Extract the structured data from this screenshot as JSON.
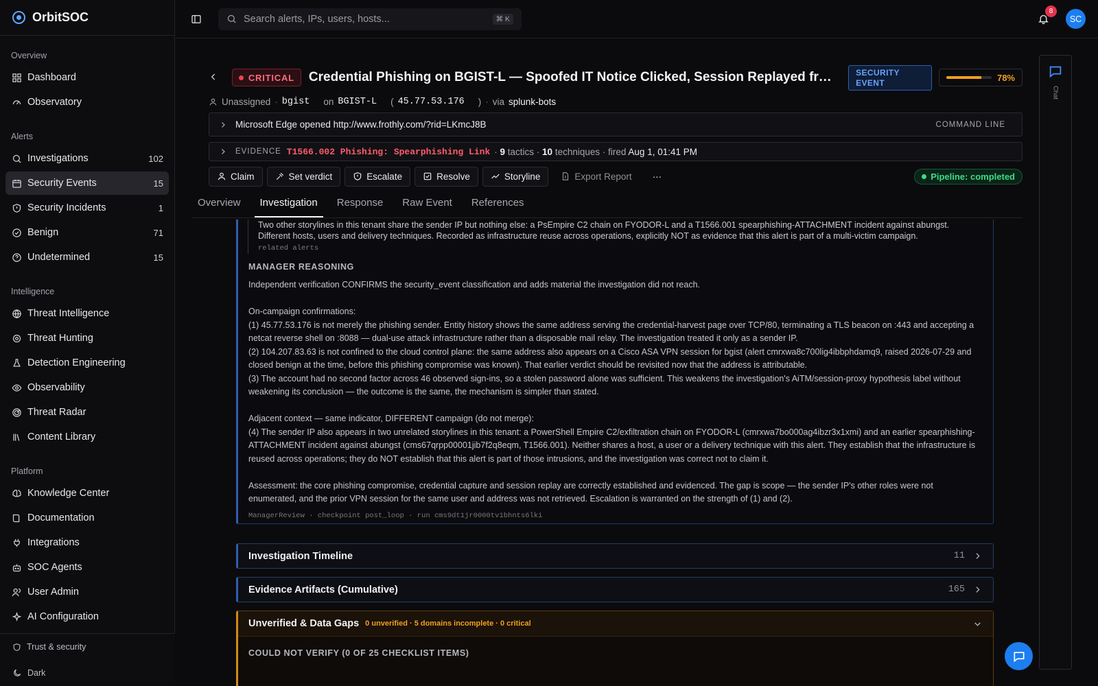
{
  "brand": {
    "name": "OrbitSOC"
  },
  "sidebar": {
    "sections": [
      {
        "title": "Overview",
        "items": [
          {
            "label": "Dashboard",
            "icon": "dashboard-icon",
            "count": ""
          },
          {
            "label": "Observatory",
            "icon": "gauge-icon",
            "count": ""
          }
        ]
      },
      {
        "title": "Alerts",
        "items": [
          {
            "label": "Investigations",
            "icon": "search-icon",
            "count": "102"
          },
          {
            "label": "Security Events",
            "icon": "calendar-alert-icon",
            "count": "15",
            "active": true
          },
          {
            "label": "Security Incidents",
            "icon": "shield-alert-icon",
            "count": "1"
          },
          {
            "label": "Benign",
            "icon": "check-circle-icon",
            "count": "71"
          },
          {
            "label": "Undetermined",
            "icon": "question-circle-icon",
            "count": "15"
          }
        ]
      },
      {
        "title": "Intelligence",
        "items": [
          {
            "label": "Threat Intelligence",
            "icon": "globe-icon",
            "count": ""
          },
          {
            "label": "Threat Hunting",
            "icon": "crosshair-icon",
            "count": ""
          },
          {
            "label": "Detection Engineering",
            "icon": "flask-icon",
            "count": ""
          },
          {
            "label": "Observability",
            "icon": "eye-icon",
            "count": ""
          },
          {
            "label": "Threat Radar",
            "icon": "radar-icon",
            "count": ""
          },
          {
            "label": "Content Library",
            "icon": "library-icon",
            "count": ""
          }
        ]
      },
      {
        "title": "Platform",
        "items": [
          {
            "label": "Knowledge Center",
            "icon": "brain-icon",
            "count": ""
          },
          {
            "label": "Documentation",
            "icon": "book-icon",
            "count": ""
          },
          {
            "label": "Integrations",
            "icon": "plug-icon",
            "count": ""
          },
          {
            "label": "SOC Agents",
            "icon": "bot-icon",
            "count": ""
          },
          {
            "label": "User Admin",
            "icon": "users-icon",
            "count": ""
          },
          {
            "label": "AI Configuration",
            "icon": "sparkles-icon",
            "count": ""
          }
        ]
      }
    ],
    "footer": {
      "trust": "Trust & security",
      "theme": "Dark"
    }
  },
  "topbar": {
    "search_placeholder": "Search alerts, IPs, users, hosts...",
    "shortcut": "⌘ K",
    "notifications": "8",
    "avatar": "SC"
  },
  "alert": {
    "severity": "CRITICAL",
    "title": "Credential Phishing on BGIST-L — Spoofed IT Notice Clicked, Session Replayed from H...",
    "classification": "SECURITY EVENT",
    "confidence_label": "78%",
    "confidence": 0.78,
    "meta": {
      "assignee": "Unassigned",
      "user": "bgist",
      "on": "on",
      "host": "BGIST-L",
      "ip_open": "(",
      "ip": "45.77.53.176",
      "ip_close": ")",
      "via": "via",
      "source": "splunk-bots"
    },
    "command": {
      "text": "Microsoft Edge opened http://www.frothly.com/?rid=LKmcJ8B",
      "tag": "COMMAND LINE"
    },
    "evidence": {
      "label": "EVIDENCE",
      "technique": "T1566.002 Phishing: Spearphishing Link",
      "tactics_count": "9",
      "tactics_label": "tactics",
      "techniques_count": "10",
      "techniques_label": "techniques · fired",
      "fired": "Aug 1, 01:41 PM"
    }
  },
  "actions": {
    "claim": "Claim",
    "verdict": "Set verdict",
    "escalate": "Escalate",
    "resolve": "Resolve",
    "storyline": "Storyline",
    "export": "Export Report",
    "more": "···",
    "pipeline": "Pipeline: completed"
  },
  "tabs": [
    "Overview",
    "Investigation",
    "Response",
    "Raw Event",
    "References"
  ],
  "related": {
    "line1": "Two other storylines in this tenant share the sender IP but nothing else: a PsEmpire C2 chain on FYODOR-L and a T1566.001 spearphishing-ATTACHMENT incident against abungst.",
    "line2": "Different hosts, users and delivery techniques. Recorded as infrastructure reuse across operations, explicitly NOT as evidence that this alert is part of a multi-victim campaign.",
    "tag": "related alerts"
  },
  "manager": {
    "heading": "MANAGER REASONING",
    "p1": "Independent verification CONFIRMS the security_event classification and adds material the investigation did not reach.",
    "p2": "On-campaign confirmations:",
    "p3": "(1) 45.77.53.176 is not merely the phishing sender. Entity history shows the same address serving the credential-harvest page over TCP/80, terminating a TLS beacon on :443 and accepting a netcat reverse shell on :8088 — dual-use attack infrastructure rather than a disposable mail relay. The investigation treated it only as a sender IP.",
    "p4": "(2) 104.207.83.63 is not confined to the cloud control plane: the same address also appears on a Cisco ASA VPN session for bgist (alert cmrxwa8c700lig4ibbphdamq9, raised 2026-07-29 and closed benign at the time, before this phishing compromise was known). That earlier verdict should be revisited now that the address is attributable.",
    "p5": "(3) The account had no second factor across 46 observed sign-ins, so a stolen password alone was sufficient. This weakens the investigation's AiTM/session-proxy hypothesis label without weakening its conclusion — the outcome is the same, the mechanism is simpler than stated.",
    "p6": "Adjacent context — same indicator, DIFFERENT campaign (do not merge):",
    "p7": "(4) The sender IP also appears in two unrelated storylines in this tenant: a PowerShell Empire C2/exfiltration chain on FYODOR-L (cmrxwa7bo000ag4ibzr3x1xmi) and an earlier spearphishing-ATTACHMENT incident against abungst (cms67qrpp00001jib7f2q8eqm, T1566.001). Neither shares a host, a user or a delivery technique with this alert. They establish that the infrastructure is reused across operations; they do NOT establish that this alert is part of those intrusions, and the investigation was correct not to claim it.",
    "p8": "Assessment: the core phishing compromise, credential capture and session replay are correctly established and evidenced. The gap is scope — the sender IP's other roles were not enumerated, and the prior VPN session for the same user and address was not retrieved. Escalation is warranted on the strength of (1) and (2).",
    "footer": "ManagerReview · checkpoint post_loop · run cms9dt1jr0000tv1bhnts6lki"
  },
  "sections": {
    "timeline": {
      "title": "Investigation Timeline",
      "count": "11"
    },
    "artifacts": {
      "title": "Evidence Artifacts (Cumulative)",
      "count": "165"
    },
    "gaps": {
      "title": "Unverified & Data Gaps",
      "summary": "0 unverified · 5 domains incomplete · 0 critical",
      "sub": "COULD NOT VERIFY (0 OF 25 CHECKLIST ITEMS)"
    }
  },
  "chat": {
    "label": "Chat"
  },
  "colors": {
    "accent": "#1d7ef0",
    "critical": "#f04158",
    "success": "#3fdb86",
    "warning": "#f0a020"
  }
}
